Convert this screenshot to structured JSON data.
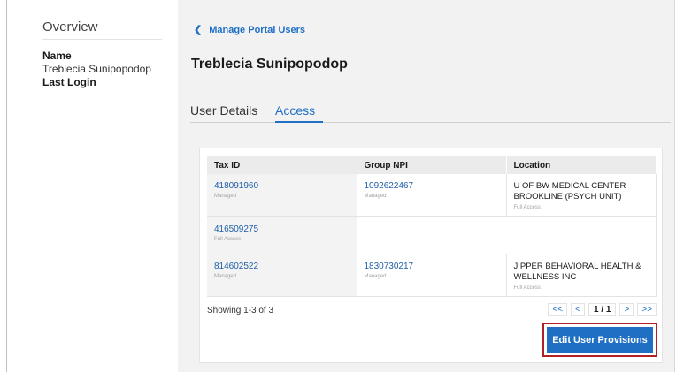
{
  "sidebar": {
    "title": "Overview",
    "name_label": "Name",
    "name_value": "Treblecia Sunipopodop",
    "last_login_label": "Last Login"
  },
  "breadcrumb": {
    "label": "Manage Portal Users"
  },
  "page_title": "Treblecia Sunipopodop",
  "tabs": [
    {
      "label": "User Details",
      "active": false
    },
    {
      "label": "Access",
      "active": true
    }
  ],
  "table": {
    "columns": [
      "Tax ID",
      "Group NPI",
      "Location"
    ],
    "rows": [
      {
        "tax_id": "418091960",
        "tax_status": "Managed",
        "npi": "1092622467",
        "npi_status": "Managed",
        "location_line1": "U OF BW MEDICAL CENTER",
        "location_line2": "BROOKLINE (PSYCH UNIT)",
        "location_status": "Full Access"
      },
      {
        "tax_id": "416509275",
        "tax_status": "Full Access",
        "npi": "",
        "npi_status": "",
        "location_line1": "",
        "location_line2": "",
        "location_status": ""
      },
      {
        "tax_id": "814602522",
        "tax_status": "Managed",
        "npi": "1830730217",
        "npi_status": "Managed",
        "location_line1": "JIPPER BEHAVIORAL HEALTH &",
        "location_line2": "WELLNESS INC",
        "location_status": "Full Access"
      }
    ]
  },
  "pagination": {
    "showing": "Showing 1-3 of 3",
    "first": "<<",
    "prev": "<",
    "page_info": "1 / 1",
    "next": ">",
    "last": ">>"
  },
  "edit_button": {
    "label": "Edit User Provisions",
    "highlight_color": "#b21f24",
    "color": "#1f6fc5"
  },
  "colors": {
    "accent": "#1f6fc5"
  }
}
